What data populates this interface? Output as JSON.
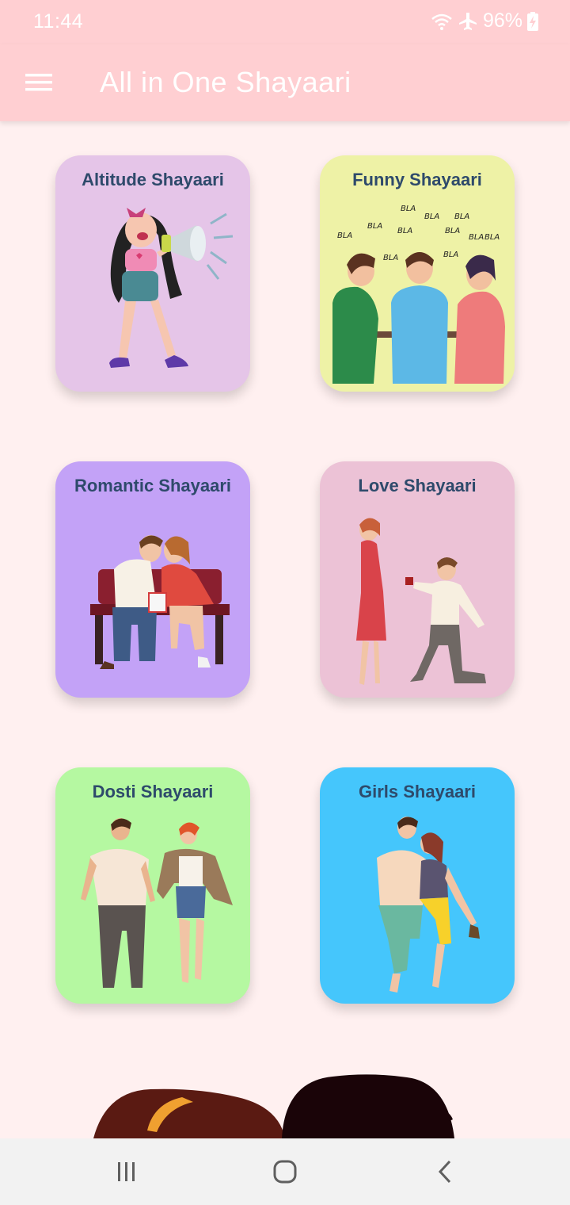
{
  "status_bar": {
    "time": "11:44",
    "battery": "96%",
    "icons": [
      "wifi-icon",
      "airplane-icon",
      "battery-charging-icon"
    ]
  },
  "app_bar": {
    "title": "All in One Shayaari",
    "menu_icon": "hamburger-menu-icon"
  },
  "categories": [
    {
      "label": "Altitude Shayaari",
      "bg": "#e5c5e8"
    },
    {
      "label": "Funny Shayaari",
      "bg": "#eef2a6"
    },
    {
      "label": "Romantic Shayaari",
      "bg": "#c3a2f7"
    },
    {
      "label": "Love Shayaari",
      "bg": "#ecc2d6"
    },
    {
      "label": "Dosti Shayaari",
      "bg": "#b5f8a1"
    },
    {
      "label": "Girls Shayaari",
      "bg": "#45c6fc"
    }
  ],
  "colors": {
    "app_bar": "#ffcfd2",
    "page_bg": "#fff0f0",
    "label_text": "#2e4a6b",
    "nav_bar": "#f2f2f2"
  },
  "nav_bar": {
    "icons": [
      "recent-apps-icon",
      "home-icon",
      "back-icon"
    ]
  }
}
